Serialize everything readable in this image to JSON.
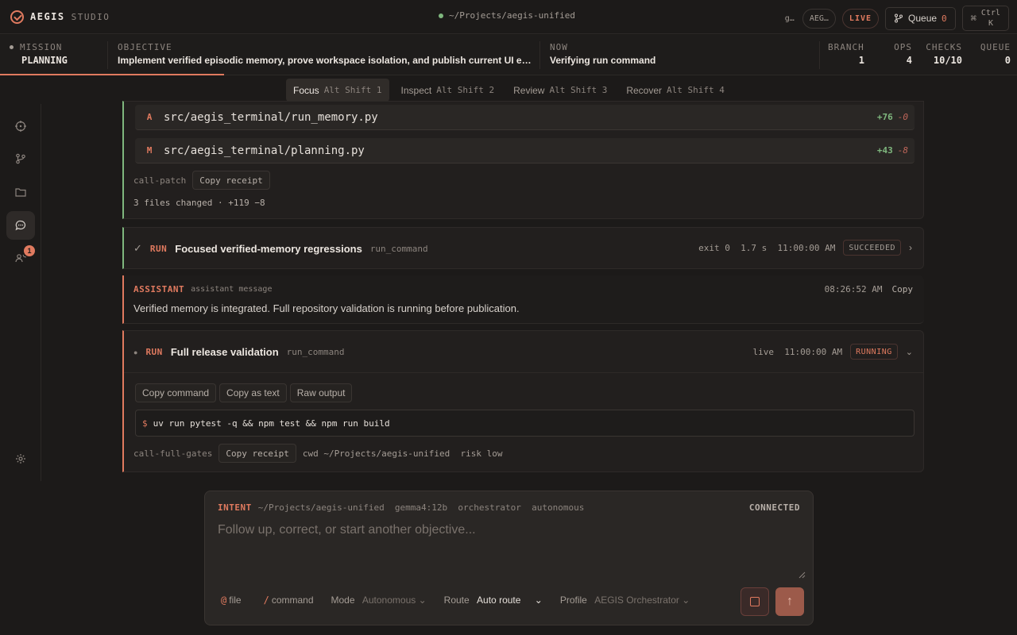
{
  "app": {
    "name": "AEGIS",
    "sub": "STUDIO",
    "path": "~/Projects/aegis-unified"
  },
  "top": {
    "truncated_1": "g…",
    "truncated_2": "AEG…",
    "live": "LIVE",
    "queue_label": "Queue",
    "queue_count": "0",
    "shortcut_key": "Ctrl",
    "shortcut_key2": "K",
    "shortcut_symbol": "⌘"
  },
  "mission": {
    "mission_label": "MISSION",
    "mission_value": "PLANNING",
    "objective_label": "OBJECTIVE",
    "objective_value": "Implement verified episodic memory, prove workspace isolation, and publish current UI e…",
    "now_label": "NOW",
    "now_value": "Verifying run command",
    "stats": [
      {
        "label": "BRANCH",
        "value": "1"
      },
      {
        "label": "OPS",
        "value": "4"
      },
      {
        "label": "CHECKS",
        "value": "10/10"
      },
      {
        "label": "QUEUE",
        "value": "0"
      }
    ]
  },
  "modes": [
    {
      "label": "Focus",
      "key": "Alt Shift 1"
    },
    {
      "label": "Inspect",
      "key": "Alt Shift 2"
    },
    {
      "label": "Review",
      "key": "Alt Shift 3"
    },
    {
      "label": "Recover",
      "key": "Alt Shift 4"
    }
  ],
  "patch": {
    "files": [
      {
        "flag": "A",
        "path": "src/aegis_terminal/run_memory.py",
        "add": "+76",
        "del": "-0"
      },
      {
        "flag": "M",
        "path": "src/aegis_terminal/planning.py",
        "add": "+43",
        "del": "-8"
      }
    ],
    "call_id": "call-patch",
    "copy_receipt": "Copy receipt",
    "summary": "3 files changed · +119 −8"
  },
  "run1": {
    "check": "✓",
    "tag": "RUN",
    "title": "Focused verified-memory regressions",
    "tool": "run_command",
    "meta": "exit 0  1.7 s  11:00:00 AM",
    "status": "SUCCEEDED"
  },
  "assistant": {
    "tag": "ASSISTANT",
    "kind": "assistant message",
    "time": "08:26:52 AM",
    "copy": "Copy",
    "text": "Verified memory is integrated. Full repository validation is running before publication."
  },
  "run2": {
    "dot": "●",
    "tag": "RUN",
    "title": "Full release validation",
    "tool": "run_command",
    "meta": "live  11:00:00 AM",
    "status": "RUNNING",
    "buttons": [
      "Copy command",
      "Copy as text",
      "Raw output"
    ],
    "prompt": "$",
    "command": "uv run pytest -q && npm test && npm run build",
    "call_id": "call-full-gates",
    "copy_receipt": "Copy receipt",
    "cwd": "cwd ~/Projects/aegis-unified  risk low"
  },
  "composer": {
    "intent": "INTENT",
    "context": "~/Projects/aegis-unified  gemma4:12b  orchestrator  autonomous",
    "connected": "CONNECTED",
    "placeholder": "Follow up, correct, or start another objective...",
    "file_sym": "@",
    "file_label": "file",
    "cmd_sym": "/",
    "cmd_label": "command",
    "mode_label": "Mode",
    "mode_value": "Autonomous",
    "route_label": "Route",
    "route_value": "Auto route",
    "profile_label": "Profile",
    "profile_value": "AEGIS Orchestrator"
  },
  "rail": {
    "badge": "1"
  },
  "colors": {
    "accent": "#e07a5f",
    "success": "#7fb77e",
    "background": "#1c1a19"
  }
}
